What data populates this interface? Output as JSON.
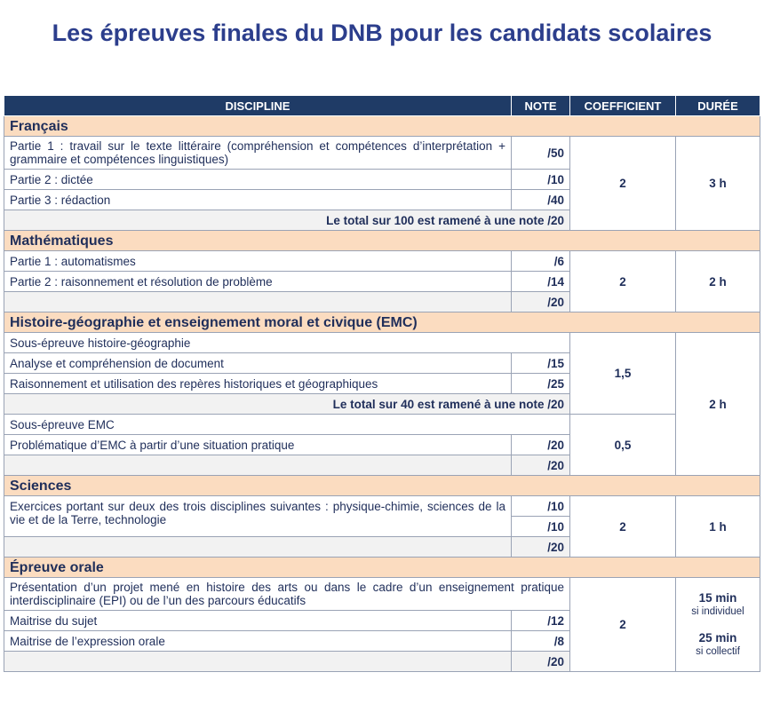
{
  "title": "Les épreuves finales du DNB pour les candidats scolaires",
  "headers": {
    "discipline": "DISCIPLINE",
    "note": "NOTE",
    "coefficient": "COEFFICIENT",
    "duree": "DURÉE"
  },
  "francais": {
    "name": "Français",
    "rows": [
      {
        "label": "Partie 1 : travail sur le texte littéraire (compréhension et compétences d’interprétation + grammaire et compétences linguistiques)",
        "note": "/50"
      },
      {
        "label": "Partie 2 : dictée",
        "note": "/10"
      },
      {
        "label": "Partie 3 : rédaction",
        "note": "/40"
      }
    ],
    "total": "Le total sur 100 est ramené à une note /20",
    "coefficient": "2",
    "duree": "3 h"
  },
  "maths": {
    "name": "Mathématiques",
    "rows": [
      {
        "label": "Partie 1 : automatismes",
        "note": "/6"
      },
      {
        "label": "Partie 2 : raisonnement et résolution de problème",
        "note": "/14"
      }
    ],
    "total": "/20",
    "coefficient": "2",
    "duree": "2 h"
  },
  "histoire": {
    "name": "Histoire-géographie et enseignement moral et civique (EMC)",
    "sub1": "Sous-épreuve histoire-géographie",
    "rows1": [
      {
        "label": "Analyse et compréhension de document",
        "note": "/15"
      },
      {
        "label": "Raisonnement et utilisation des repères historiques et géographiques",
        "note": "/25"
      }
    ],
    "total1": "Le total sur 40 est ramené à une note /20",
    "coefficient1": "1,5",
    "sub2": "Sous-épreuve EMC",
    "rows2": [
      {
        "label": "Problématique d’EMC à partir d’une situation pratique",
        "note": "/20"
      }
    ],
    "total2": "/20",
    "coefficient2": "0,5",
    "duree": "2 h"
  },
  "sciences": {
    "name": "Sciences",
    "label": "Exercices portant sur deux des trois disciplines suivantes : physique-chimie, sciences de la vie et de la Terre, technologie",
    "notes": [
      "/10",
      "/10"
    ],
    "total": "/20",
    "coefficient": "2",
    "duree": "1 h"
  },
  "oral": {
    "name": "Épreuve orale",
    "intro": "Présentation d’un projet mené en histoire des arts ou dans le cadre d’un enseignement pratique interdisciplinaire (EPI) ou de l’un des parcours éducatifs",
    "rows": [
      {
        "label": "Maitrise du sujet",
        "note": "/12"
      },
      {
        "label": "Maitrise de l’expression orale",
        "note": "/8"
      }
    ],
    "total": "/20",
    "coefficient": "2",
    "duree1": "15 min",
    "duree1_sub": "si individuel",
    "duree2": "25 min",
    "duree2_sub": "si collectif"
  }
}
